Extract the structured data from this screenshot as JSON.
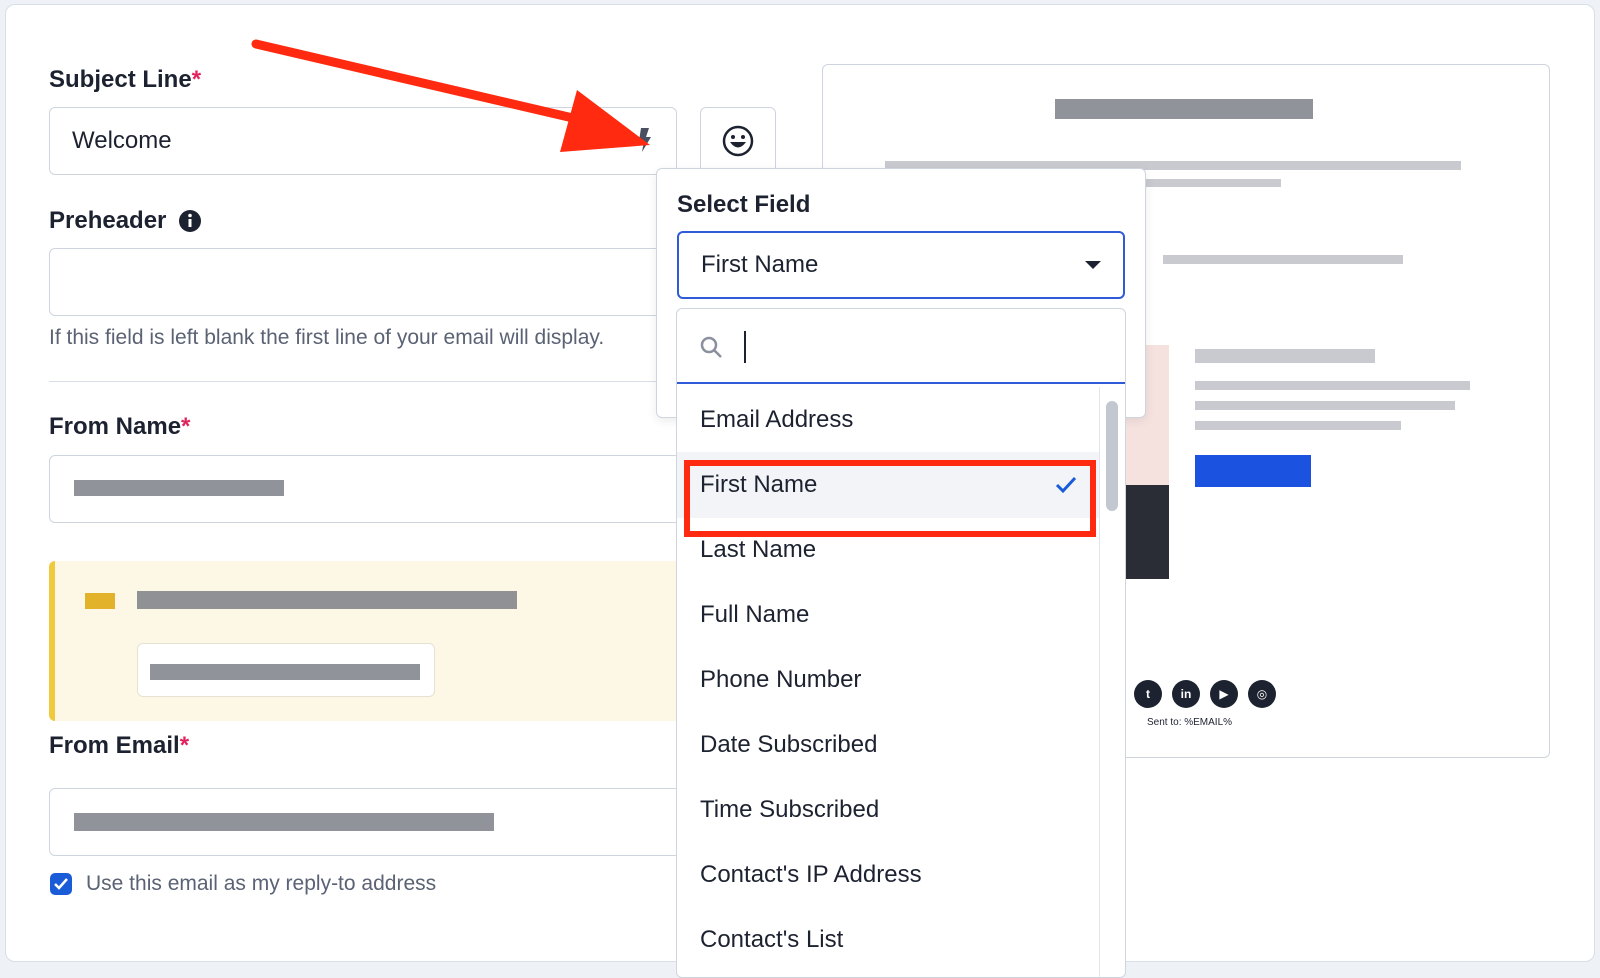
{
  "form": {
    "subject": {
      "label": "Subject Line",
      "required": "*",
      "value": "Welcome"
    },
    "preheader": {
      "label": "Preheader",
      "value": "",
      "help": "If this field is left blank the first line of your email will display."
    },
    "from_name": {
      "label": "From Name",
      "required": "*"
    },
    "from_email": {
      "label": "From Email",
      "required": "*"
    },
    "reply_to": {
      "label": "Use this email as my reply-to address",
      "checked": true
    }
  },
  "select_field": {
    "title": "Select Field",
    "selected": "First Name",
    "search_value": "",
    "options": [
      {
        "label": "Email Address"
      },
      {
        "label": "First Name",
        "selected": true
      },
      {
        "label": "Last Name"
      },
      {
        "label": "Full Name"
      },
      {
        "label": "Phone Number"
      },
      {
        "label": "Date Subscribed"
      },
      {
        "label": "Time Subscribed"
      },
      {
        "label": "Contact's IP Address"
      },
      {
        "label": "Contact's List"
      }
    ]
  },
  "preview": {
    "footer_text": "Sent to: %EMAIL%",
    "social": [
      "twitter-icon",
      "linkedin-icon",
      "youtube-icon",
      "instagram-icon"
    ]
  },
  "colors": {
    "accent": "#1a5cd7",
    "required": "#e0245e",
    "annotation": "#ff2a0f",
    "notice_bg": "#fdf8e6",
    "notice_border": "#f0c93d"
  }
}
